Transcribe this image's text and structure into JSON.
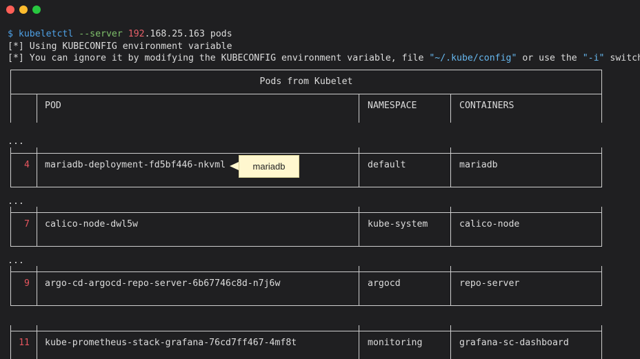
{
  "window": {
    "buttons": [
      "close",
      "minimize",
      "zoom"
    ]
  },
  "command": {
    "prompt": "$",
    "binary": "kubeletctl",
    "flag": "--server",
    "ip_head": "192",
    "ip_tail": ".168.25.163",
    "subcommand": "pods"
  },
  "messages": {
    "line1": "[*] Using KUBECONFIG environment variable",
    "line2_a": "[*] You can ignore it by modifying the KUBECONFIG environment variable, file ",
    "line2_path": "\"~/.kube/config\"",
    "line2_b": " or use the ",
    "line2_flag": "\"-i\"",
    "line2_c": " switch"
  },
  "table": {
    "title": "Pods from Kubelet",
    "headers": {
      "index": "",
      "pod": "POD",
      "namespace": "NAMESPACE",
      "containers": "CONTAINERS"
    },
    "ellipsis": "...",
    "rows": [
      {
        "index": "4",
        "pod": "mariadb-deployment-fd5bf446-nkvml",
        "namespace": "default",
        "containers": "mariadb"
      },
      {
        "index": "7",
        "pod": "calico-node-dwl5w",
        "namespace": "kube-system",
        "containers": "calico-node"
      },
      {
        "index": "9",
        "pod": "argo-cd-argocd-repo-server-6b67746c8d-n7j6w",
        "namespace": "argocd",
        "containers": "repo-server"
      },
      {
        "index": "11",
        "pod": "kube-prometheus-stack-grafana-76cd7ff467-4mf8t",
        "namespace": "monitoring",
        "containers": "grafana-sc-dashboard"
      }
    ]
  },
  "annotation": {
    "text": "mariadb"
  },
  "colors": {
    "background": "#1f1f21",
    "accent_blue": "#4ea1e6",
    "accent_green": "#7fc06b",
    "accent_red": "#e5555e",
    "callout_bg": "#fff7cf"
  }
}
